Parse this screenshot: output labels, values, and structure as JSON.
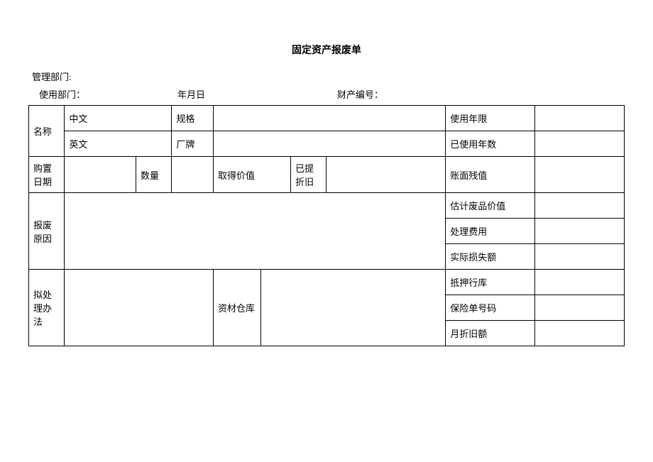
{
  "title": "固定资产报废单",
  "header": {
    "mgmt_dept_label": "管理部门:",
    "use_dept_label": "使用部门：",
    "date_label": "年月日",
    "asset_no_label": "财产编号："
  },
  "labels": {
    "name": "名称",
    "chinese": "中文",
    "spec": "规格",
    "useful_life": "使用年限",
    "english": "英文",
    "brand": "厂牌",
    "used_years": "已使用年数",
    "purchase_date": "购置日期",
    "quantity": "数量",
    "acquire_value": "取得价值",
    "accum_dep": "已提折旧",
    "book_residual": "账面残值",
    "scrap_reason": "报废原因",
    "est_scrap_value": "估计废品价值",
    "disposal_fee": "处理费用",
    "actual_loss": "实际损失额",
    "disposal_method": "拟处理办法",
    "material_warehouse": "资材仓库",
    "mortgage_bank": "抵押行库",
    "insurance_no": "保险单号码",
    "monthly_dep": "月折旧额"
  }
}
